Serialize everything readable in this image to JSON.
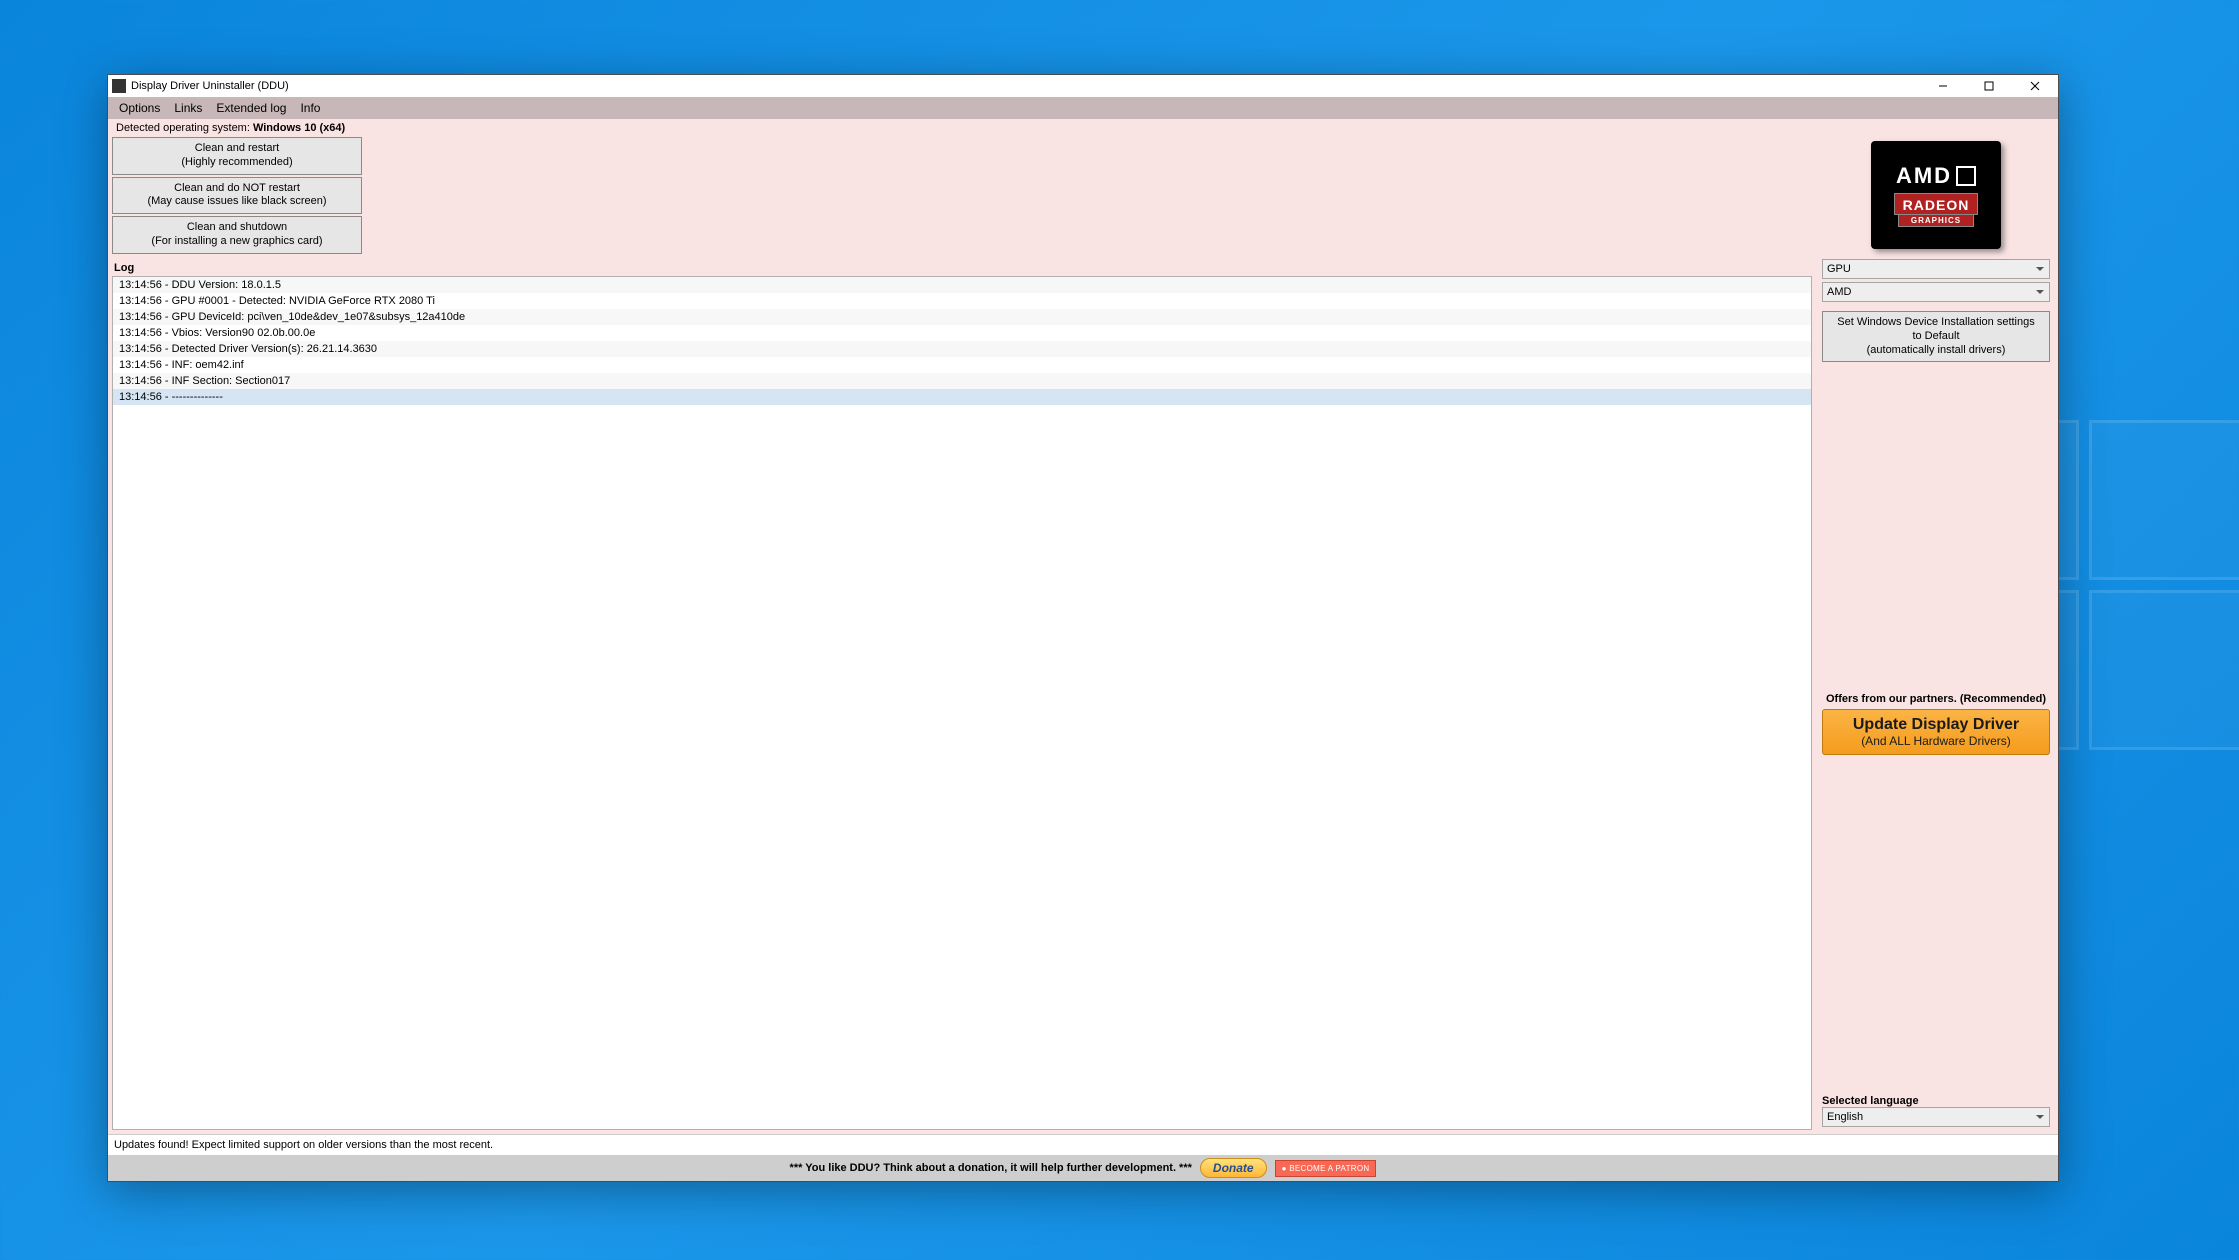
{
  "titlebar": {
    "title": "Display Driver Uninstaller (DDU)"
  },
  "menu": {
    "options": "Options",
    "links": "Links",
    "extended": "Extended log",
    "info": "Info"
  },
  "os_detect": {
    "prefix": "Detected operating system: ",
    "value": "Windows 10 (x64)"
  },
  "actions": {
    "clean_restart_l1": "Clean and restart",
    "clean_restart_l2": "(Highly recommended)",
    "clean_norestart_l1": "Clean and do NOT restart",
    "clean_norestart_l2": "(May cause issues like black screen)",
    "clean_shutdown_l1": "Clean and shutdown",
    "clean_shutdown_l2": "(For installing a new graphics card)"
  },
  "log": {
    "label": "Log",
    "entries": [
      "13:14:56 - DDU Version: 18.0.1.5",
      "13:14:56 - GPU #0001 - Detected: NVIDIA GeForce RTX 2080 Ti",
      "13:14:56 - GPU DeviceId: pci\\ven_10de&dev_1e07&subsys_12a410de",
      "13:14:56 - Vbios: Version90 02.0b.00.0e",
      "13:14:56 - Detected Driver Version(s): 26.21.14.3630",
      "13:14:56 - INF: oem42.inf",
      "13:14:56 - INF Section: Section017",
      "13:14:56 - --------------"
    ]
  },
  "side": {
    "brand_top": "AMD",
    "brand_mid": "RADEON",
    "brand_bot": "GRAPHICS",
    "device_type": "GPU",
    "vendor": "AMD",
    "set_default_l1": "Set Windows Device Installation settings",
    "set_default_l2": "to Default",
    "set_default_l3": "(automatically install drivers)",
    "offers_label": "Offers from our partners. (Recommended)",
    "update_l1": "Update Display Driver",
    "update_l2": "(And ALL Hardware Drivers)",
    "lang_label": "Selected language",
    "lang_value": "English"
  },
  "status": {
    "text": "Updates found! Expect limited support on older versions than the most recent."
  },
  "donate": {
    "msg": "*** You like DDU? Think about a donation, it will help further development. ***",
    "donate_label": "Donate",
    "patron_label": "● BECOME A PATRON"
  }
}
